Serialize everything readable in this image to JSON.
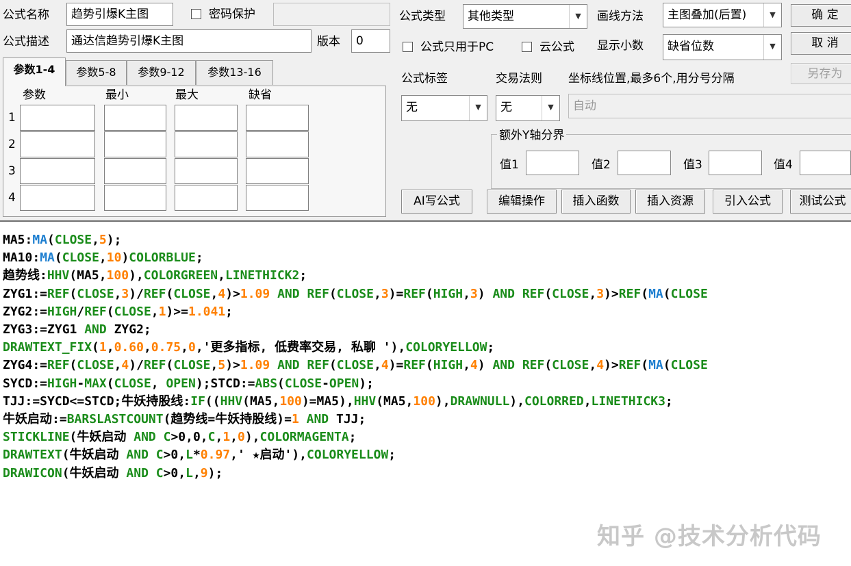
{
  "formula_name": {
    "label": "公式名称",
    "value": "趋势引爆K主图"
  },
  "password": {
    "label": "密码保护",
    "value": ""
  },
  "formula_desc": {
    "label": "公式描述",
    "value": "通达信趋势引爆K主图"
  },
  "version": {
    "label": "版本",
    "value": "0"
  },
  "formula_type": {
    "label": "公式类型",
    "value": "其他类型"
  },
  "draw_method": {
    "label": "画线方法",
    "value": "主图叠加(后置)"
  },
  "pc_only": {
    "label": "公式只用于PC"
  },
  "cloud": {
    "label": "云公式"
  },
  "decimals": {
    "label": "显示小数",
    "value": "缺省位数"
  },
  "buttons": {
    "ok": "确 定",
    "cancel": "取 消",
    "save_as": "另存为",
    "ai": "AI写公式",
    "edit": "编辑操作",
    "insert_func": "插入函数",
    "insert_res": "插入资源",
    "import": "引入公式",
    "test": "测试公式"
  },
  "tabs": [
    "参数1-4",
    "参数5-8",
    "参数9-12",
    "参数13-16"
  ],
  "param_headers": [
    "参数",
    "最小",
    "最大",
    "缺省"
  ],
  "param_rows": [
    "1",
    "2",
    "3",
    "4"
  ],
  "tag": {
    "label": "公式标签",
    "value": "无"
  },
  "trade_rule": {
    "label": "交易法则",
    "value": "无"
  },
  "axis_pos": {
    "label": "坐标线位置,最多6个,用分号分隔",
    "value": "自动"
  },
  "extra_y": {
    "title": "额外Y轴分界",
    "labels": [
      "值1",
      "值2",
      "值3",
      "值4"
    ]
  },
  "colors": {
    "keyword": "#1a8c1a",
    "number": "#ff8000",
    "ma": "#1e7fd0",
    "text": "#000000"
  },
  "code_lines": [
    [
      [
        "t",
        "MA5:"
      ],
      [
        "m",
        "MA"
      ],
      [
        "t",
        "("
      ],
      [
        "k",
        "CLOSE"
      ],
      [
        "t",
        ","
      ],
      [
        "n",
        "5"
      ],
      [
        "t",
        ");"
      ]
    ],
    [
      [
        "t",
        "MA10:"
      ],
      [
        "m",
        "MA"
      ],
      [
        "t",
        "("
      ],
      [
        "k",
        "CLOSE"
      ],
      [
        "t",
        ","
      ],
      [
        "n",
        "10"
      ],
      [
        "t",
        ")"
      ],
      [
        "k",
        "COLORBLUE"
      ],
      [
        "t",
        ";"
      ]
    ],
    [
      [
        "t",
        "趋势线:"
      ],
      [
        "k",
        "HHV"
      ],
      [
        "t",
        "(MA5,"
      ],
      [
        "n",
        "100"
      ],
      [
        "t",
        "),"
      ],
      [
        "k",
        "COLORGREEN"
      ],
      [
        "t",
        ","
      ],
      [
        "k",
        "LINETHICK2"
      ],
      [
        "t",
        ";"
      ]
    ],
    [
      [
        "t",
        "ZYG1:="
      ],
      [
        "k",
        "REF"
      ],
      [
        "t",
        "("
      ],
      [
        "k",
        "CLOSE"
      ],
      [
        "t",
        ","
      ],
      [
        "n",
        "3"
      ],
      [
        "t",
        ")/"
      ],
      [
        "k",
        "REF"
      ],
      [
        "t",
        "("
      ],
      [
        "k",
        "CLOSE"
      ],
      [
        "t",
        ","
      ],
      [
        "n",
        "4"
      ],
      [
        "t",
        ")>"
      ],
      [
        "n",
        "1.09"
      ],
      [
        "t",
        " "
      ],
      [
        "k",
        "AND"
      ],
      [
        "t",
        " "
      ],
      [
        "k",
        "REF"
      ],
      [
        "t",
        "("
      ],
      [
        "k",
        "CLOSE"
      ],
      [
        "t",
        ","
      ],
      [
        "n",
        "3"
      ],
      [
        "t",
        ")="
      ],
      [
        "k",
        "REF"
      ],
      [
        "t",
        "("
      ],
      [
        "k",
        "HIGH"
      ],
      [
        "t",
        ","
      ],
      [
        "n",
        "3"
      ],
      [
        "t",
        ") "
      ],
      [
        "k",
        "AND"
      ],
      [
        "t",
        " "
      ],
      [
        "k",
        "REF"
      ],
      [
        "t",
        "("
      ],
      [
        "k",
        "CLOSE"
      ],
      [
        "t",
        ","
      ],
      [
        "n",
        "3"
      ],
      [
        "t",
        ")>"
      ],
      [
        "k",
        "REF"
      ],
      [
        "t",
        "("
      ],
      [
        "m",
        "MA"
      ],
      [
        "t",
        "("
      ],
      [
        "k",
        "CLOSE"
      ]
    ],
    [
      [
        "t",
        "ZYG2:="
      ],
      [
        "k",
        "HIGH"
      ],
      [
        "t",
        "/"
      ],
      [
        "k",
        "REF"
      ],
      [
        "t",
        "("
      ],
      [
        "k",
        "CLOSE"
      ],
      [
        "t",
        ","
      ],
      [
        "n",
        "1"
      ],
      [
        "t",
        ")>="
      ],
      [
        "n",
        "1.041"
      ],
      [
        "t",
        ";"
      ]
    ],
    [
      [
        "t",
        "ZYG3:=ZYG1 "
      ],
      [
        "k",
        "AND"
      ],
      [
        "t",
        " ZYG2;"
      ]
    ],
    [
      [
        "k",
        "DRAWTEXT_FIX"
      ],
      [
        "t",
        "("
      ],
      [
        "n",
        "1"
      ],
      [
        "t",
        ","
      ],
      [
        "n",
        "0.60"
      ],
      [
        "t",
        ","
      ],
      [
        "n",
        "0.75"
      ],
      [
        "t",
        ","
      ],
      [
        "n",
        "0"
      ],
      [
        "t",
        ",'更多指标, 低费率交易, 私聊 '),"
      ],
      [
        "k",
        "COLORYELLOW"
      ],
      [
        "t",
        ";"
      ]
    ],
    [
      [
        "t",
        "ZYG4:="
      ],
      [
        "k",
        "REF"
      ],
      [
        "t",
        "("
      ],
      [
        "k",
        "CLOSE"
      ],
      [
        "t",
        ","
      ],
      [
        "n",
        "4"
      ],
      [
        "t",
        ")/"
      ],
      [
        "k",
        "REF"
      ],
      [
        "t",
        "("
      ],
      [
        "k",
        "CLOSE"
      ],
      [
        "t",
        ","
      ],
      [
        "n",
        "5"
      ],
      [
        "t",
        ")>"
      ],
      [
        "n",
        "1.09"
      ],
      [
        "t",
        " "
      ],
      [
        "k",
        "AND"
      ],
      [
        "t",
        " "
      ],
      [
        "k",
        "REF"
      ],
      [
        "t",
        "("
      ],
      [
        "k",
        "CLOSE"
      ],
      [
        "t",
        ","
      ],
      [
        "n",
        "4"
      ],
      [
        "t",
        ")="
      ],
      [
        "k",
        "REF"
      ],
      [
        "t",
        "("
      ],
      [
        "k",
        "HIGH"
      ],
      [
        "t",
        ","
      ],
      [
        "n",
        "4"
      ],
      [
        "t",
        ") "
      ],
      [
        "k",
        "AND"
      ],
      [
        "t",
        " "
      ],
      [
        "k",
        "REF"
      ],
      [
        "t",
        "("
      ],
      [
        "k",
        "CLOSE"
      ],
      [
        "t",
        ","
      ],
      [
        "n",
        "4"
      ],
      [
        "t",
        ")>"
      ],
      [
        "k",
        "REF"
      ],
      [
        "t",
        "("
      ],
      [
        "m",
        "MA"
      ],
      [
        "t",
        "("
      ],
      [
        "k",
        "CLOSE"
      ]
    ],
    [
      [
        "t",
        "SYCD:="
      ],
      [
        "k",
        "HIGH"
      ],
      [
        "t",
        "-"
      ],
      [
        "k",
        "MAX"
      ],
      [
        "t",
        "("
      ],
      [
        "k",
        "CLOSE"
      ],
      [
        "t",
        ", "
      ],
      [
        "k",
        "OPEN"
      ],
      [
        "t",
        ");STCD:="
      ],
      [
        "k",
        "ABS"
      ],
      [
        "t",
        "("
      ],
      [
        "k",
        "CLOSE"
      ],
      [
        "t",
        "-"
      ],
      [
        "k",
        "OPEN"
      ],
      [
        "t",
        ");"
      ]
    ],
    [
      [
        "t",
        "TJJ:=SYCD<=STCD;牛妖持股线:"
      ],
      [
        "k",
        "IF"
      ],
      [
        "t",
        "(("
      ],
      [
        "k",
        "HHV"
      ],
      [
        "t",
        "(MA5,"
      ],
      [
        "n",
        "100"
      ],
      [
        "t",
        ")=MA5),"
      ],
      [
        "k",
        "HHV"
      ],
      [
        "t",
        "(MA5,"
      ],
      [
        "n",
        "100"
      ],
      [
        "t",
        "),"
      ],
      [
        "k",
        "DRAWNULL"
      ],
      [
        "t",
        "),"
      ],
      [
        "k",
        "COLORRED"
      ],
      [
        "t",
        ","
      ],
      [
        "k",
        "LINETHICK3"
      ],
      [
        "t",
        ";"
      ]
    ],
    [
      [
        "t",
        "牛妖启动:="
      ],
      [
        "k",
        "BARSLASTCOUNT"
      ],
      [
        "t",
        "(趋势线=牛妖持股线)="
      ],
      [
        "n",
        "1"
      ],
      [
        "t",
        " "
      ],
      [
        "k",
        "AND"
      ],
      [
        "t",
        " TJJ;"
      ]
    ],
    [
      [
        "k",
        "STICKLINE"
      ],
      [
        "t",
        "(牛妖启动 "
      ],
      [
        "k",
        "AND"
      ],
      [
        "t",
        " "
      ],
      [
        "k",
        "C"
      ],
      [
        "t",
        ">0,0,"
      ],
      [
        "k",
        "C"
      ],
      [
        "t",
        ","
      ],
      [
        "n",
        "1"
      ],
      [
        "t",
        ","
      ],
      [
        "n",
        "0"
      ],
      [
        "t",
        "),"
      ],
      [
        "k",
        "COLORMAGENTA"
      ],
      [
        "t",
        ";"
      ]
    ],
    [
      [
        "k",
        "DRAWTEXT"
      ],
      [
        "t",
        "(牛妖启动 "
      ],
      [
        "k",
        "AND"
      ],
      [
        "t",
        " "
      ],
      [
        "k",
        "C"
      ],
      [
        "t",
        ">0,"
      ],
      [
        "k",
        "L"
      ],
      [
        "t",
        "*"
      ],
      [
        "n",
        "0.97"
      ],
      [
        "t",
        ",' ★启动'),"
      ],
      [
        "k",
        "COLORYELLOW"
      ],
      [
        "t",
        ";"
      ]
    ],
    [
      [
        "k",
        "DRAWICON"
      ],
      [
        "t",
        "(牛妖启动 "
      ],
      [
        "k",
        "AND"
      ],
      [
        "t",
        " "
      ],
      [
        "k",
        "C"
      ],
      [
        "t",
        ">0,"
      ],
      [
        "k",
        "L"
      ],
      [
        "t",
        ","
      ],
      [
        "n",
        "9"
      ],
      [
        "t",
        ");"
      ]
    ]
  ],
  "watermark": "知乎 @技术分析代码"
}
